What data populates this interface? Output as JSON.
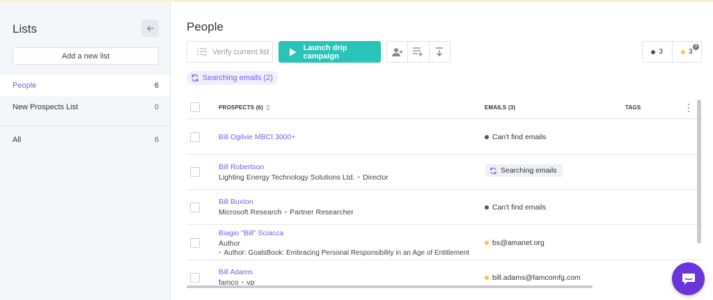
{
  "sidebar": {
    "title": "Lists",
    "add_list_label": "Add a new list",
    "items": [
      {
        "name": "People",
        "count": "6"
      },
      {
        "name": "New Prospects List",
        "count": "0"
      },
      {
        "name": "All",
        "count": "6"
      }
    ]
  },
  "main": {
    "title": "People",
    "toolbar": {
      "verify_label": "Verify current list",
      "launch_label": "Launch drip campaign"
    },
    "stats": {
      "dark_count": "3",
      "yellow_count": "3",
      "help": "?"
    },
    "searching_chip": "Searching emails (2)",
    "table": {
      "headers": {
        "prospects": "PROSPECTS (6)",
        "emails": "EMAILS (3)",
        "tags": "TAGS"
      },
      "rows": [
        {
          "name": "Bill Ogilvie MBCI 3000+",
          "company": "",
          "title": "",
          "extra": "",
          "email": "Can't find emails",
          "email_status": "none"
        },
        {
          "name": "Bill Robertson",
          "company": "Lighting Energy Technology Solutions Ltd.",
          "title": "Director",
          "extra": "",
          "email": "Searching emails",
          "email_status": "searching"
        },
        {
          "name": "Bill Buxton",
          "company": "Microsoft Research",
          "title": "Partner Researcher",
          "extra": "",
          "email": "Can't find emails",
          "email_status": "none"
        },
        {
          "name": "Biagio \"Bill\" Sciacca",
          "company": "Author",
          "title": "",
          "extra": "Author: GoalsBook: Embracing Personal Responsibility in an Age of Entitlement",
          "email": "bs@amanet.org",
          "email_status": "found"
        },
        {
          "name": "Bill Adams",
          "company": "famco",
          "title": "vp",
          "extra": "",
          "email": "bill.adams@famcomfg.com",
          "email_status": "found"
        }
      ]
    }
  },
  "colors": {
    "accent": "#7a5cf0",
    "launch": "#29c3b8",
    "chat": "#6c35d9",
    "found_dot": "#f3c94a",
    "none_dot": "#555555"
  }
}
